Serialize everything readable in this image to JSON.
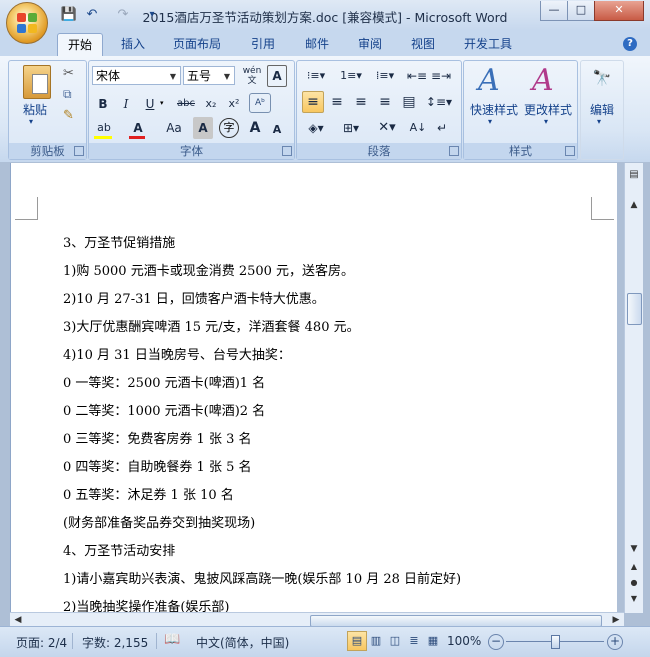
{
  "window": {
    "title": "2015酒店万圣节活动策划方案.doc [兼容模式] - Microsoft Word",
    "controls": {
      "minimize": "—",
      "maximize": "□",
      "close": "✕"
    }
  },
  "qat": {
    "save_icon": "💾",
    "undo_icon": "↶",
    "redo_icon": "↷",
    "customize_icon": "▾"
  },
  "tabs": [
    "开始",
    "插入",
    "页面布局",
    "引用",
    "邮件",
    "审阅",
    "视图",
    "开发工具"
  ],
  "active_tab": "开始",
  "ribbon": {
    "clipboard": {
      "label": "剪贴板",
      "paste": "粘贴"
    },
    "font": {
      "label": "字体",
      "font_name": "宋体",
      "font_size": "五号",
      "bold": "B",
      "italic": "I",
      "underline": "U",
      "strike": "abc",
      "subscript": "x₂",
      "superscript": "x²",
      "font_color": "A",
      "change_case": "Aa",
      "char_shading": "A",
      "enclose": "字",
      "grow": "A",
      "shrink": "A",
      "phonetic": "wén 文",
      "border_a": "A"
    },
    "paragraph": {
      "label": "段落"
    },
    "styles": {
      "label": "样式",
      "quick": "快速样式",
      "change": "更改样式"
    },
    "editing": {
      "label": "编辑"
    }
  },
  "document": {
    "lines": [
      "3、万圣节促销措施",
      "1)购 5000 元酒卡或现金消费 2500 元，送客房。",
      "2)10 月 27-31 日，回馈客户酒卡特大优惠。",
      "3)大厅优惠酬宾啤酒 15 元/支，洋酒套餐 480 元。",
      "4)10 月 31 日当晚房号、台号大抽奖：",
      "0 一等奖：2500 元酒卡(啤酒)1 名",
      "0 二等奖：1000 元酒卡(啤酒)2 名",
      "0 三等奖：免费客房券 1 张 3 名",
      "0 四等奖：自助晚餐券 1 张 5 名",
      "0 五等奖：沐足券 1 张 10 名",
      "(财务部准备奖品券交到抽奖现场)",
      "4、万圣节活动安排",
      "1)请小嘉宾助兴表演、鬼披风踩高跷一晚(娱乐部 10 月 28 日前定好)",
      "2)当晚抽奖操作准备(娱乐部)"
    ]
  },
  "status": {
    "page": "页面: 2/4",
    "words": "字数: 2,155",
    "language": "中文(简体，中国)",
    "zoom": "100%",
    "zoom_level": 1.0
  },
  "colors": {
    "accent": "#15428b",
    "font_color_bar": "#e02020",
    "highlight_bar": "#ffff00"
  }
}
